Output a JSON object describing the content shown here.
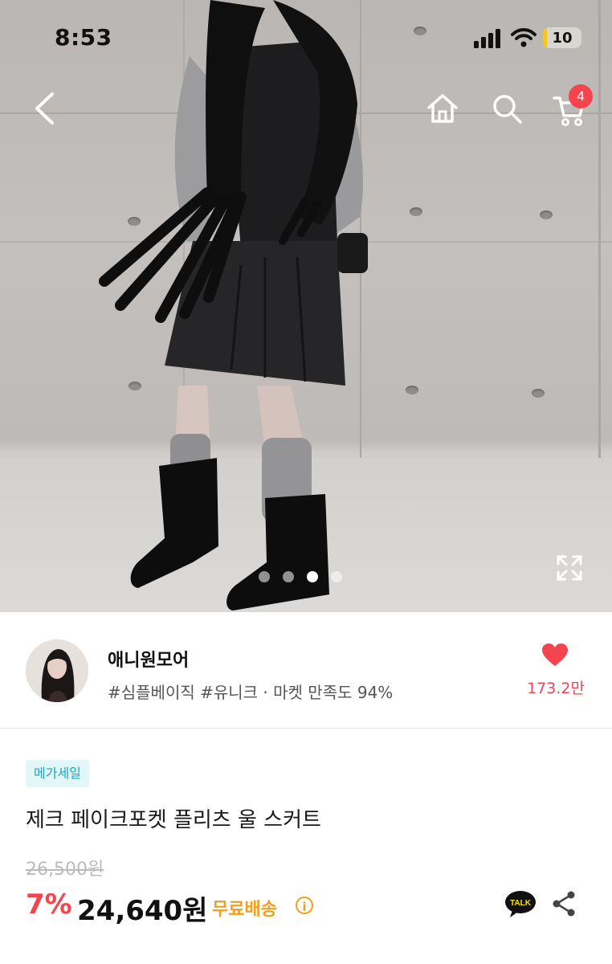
{
  "status_bar": {
    "time": "8:53",
    "battery": "10",
    "battery_level": 0.1
  },
  "header": {
    "cart_count": "4"
  },
  "gallery": {
    "total_images": 4,
    "active_index": 2
  },
  "seller": {
    "name": "애니원모어",
    "tags": "#심플베이직 #유니크 · 마켓 만족도 94%",
    "likes": "173.2만"
  },
  "product": {
    "badge": "메가세일",
    "title": "제크 페이크포켓 플리츠 울 스커트",
    "original_price": "26,500원",
    "discount": "7%",
    "price": "24,640원",
    "shipping": "무료배송",
    "info_glyph": "i",
    "talk_label": "TALK"
  },
  "icons": [
    "back-icon",
    "home-icon",
    "search-icon",
    "cart-icon",
    "expand-icon",
    "heart-icon",
    "info-icon",
    "kakao-talk-icon",
    "share-icon"
  ],
  "colors": {
    "accent_red": "#f4454f",
    "shipping_orange": "#f0a020",
    "tag_teal": "#1aa8bd"
  }
}
